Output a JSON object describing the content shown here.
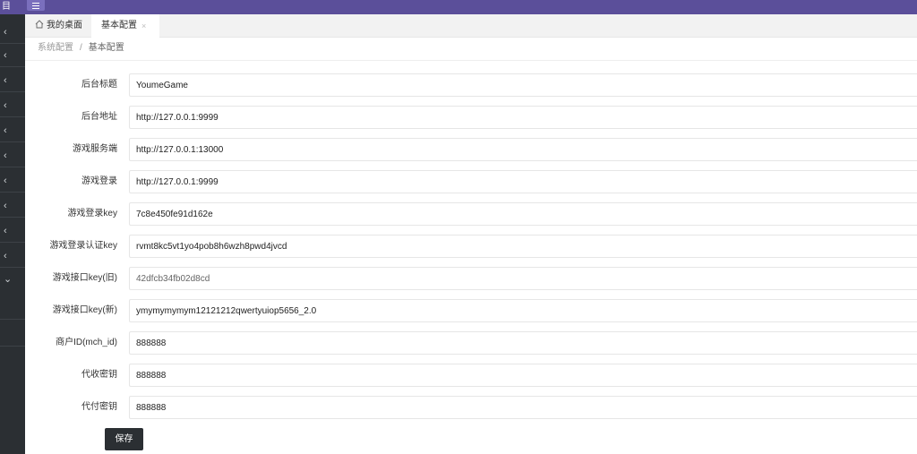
{
  "topbar": {
    "logo_glyph": "目",
    "menu_icon": "menu-list-icon",
    "color": "#5b4f9a"
  },
  "sidebar": {
    "collapsed_items_count": 10,
    "icons": [
      "chevron-left-icon",
      "chevron-down-icon"
    ],
    "color": "#2b2f33"
  },
  "tabs": [
    {
      "label": "我的桌面",
      "icon": "home-icon"
    },
    {
      "label": "基本配置",
      "close": "×"
    }
  ],
  "breadcrumb": {
    "parent": "系统配置",
    "separator": "/",
    "current": "基本配置"
  },
  "form": {
    "fields": [
      {
        "label": "后台标题",
        "value": "YoumeGame"
      },
      {
        "label": "后台地址",
        "value": "http://127.0.0.1:9999"
      },
      {
        "label": "游戏服务端",
        "value": "http://127.0.0.1:13000"
      },
      {
        "label": "游戏登录",
        "value": "http://127.0.0.1:9999"
      },
      {
        "label": "游戏登录key",
        "value": "7c8e450fe91d162e"
      },
      {
        "label": "游戏登录认证key",
        "value": "rvmt8kc5vt1yo4pob8h6wzh8pwd4jvcd"
      },
      {
        "label": "游戏接口key(旧)",
        "value": "42dfcb34fb02d8cd"
      },
      {
        "label": "游戏接口key(新)",
        "value": "ymymymymym12121212qwertyuiop5656_2.0"
      },
      {
        "label": "商户ID(mch_id)",
        "value": "888888"
      },
      {
        "label": "代收密钥",
        "value": "888888"
      },
      {
        "label": "代付密钥",
        "value": "888888"
      }
    ],
    "save_label": "保存"
  }
}
